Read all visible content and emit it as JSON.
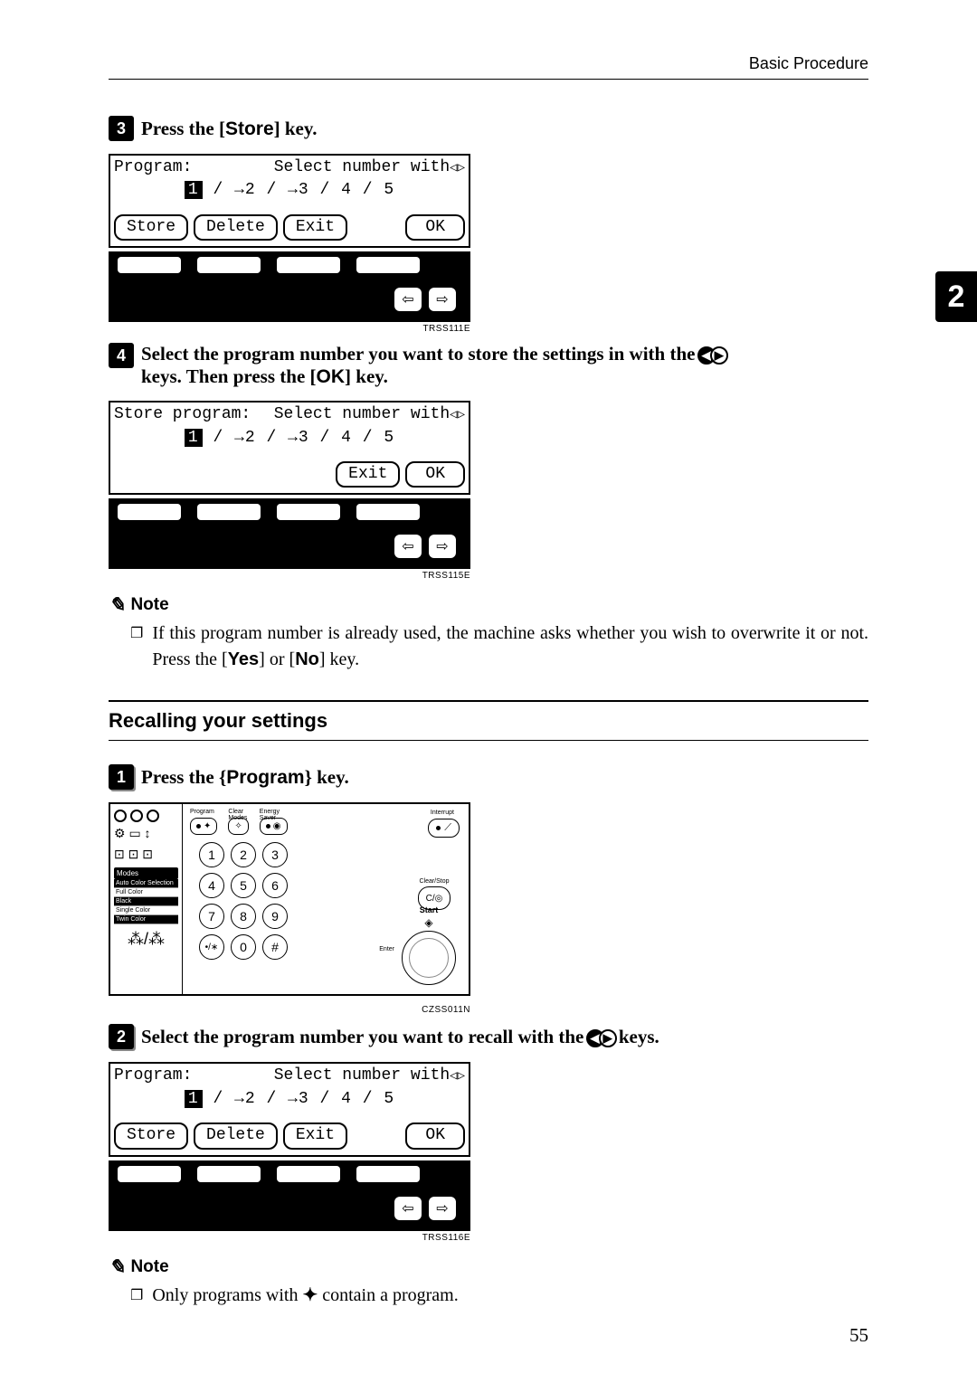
{
  "header": {
    "section": "Basic Procedure"
  },
  "chapter_tab": "2",
  "page_number": "55",
  "steps_a": [
    {
      "num": "3",
      "prefix": "Press the ",
      "key_open": "[",
      "key_label": "Store",
      "key_close": "]",
      "suffix": " key."
    },
    {
      "num": "4",
      "prefix": "Select the program number you want to store the settings in with the ",
      "suffix_line2a": "keys. Then press the ",
      "key2_open": "[",
      "key2_label": "OK",
      "key2_close": "]",
      "suffix_line2b": " key."
    }
  ],
  "figure1": {
    "title_left": "Program:",
    "title_right": "Select number with",
    "row2_sel": "1",
    "row2_rest": " / →2 / →3 /  4  /   5",
    "btns": [
      "Store",
      "Delete",
      "Exit",
      "OK"
    ],
    "code": "TRSS111E"
  },
  "figure2": {
    "title_left": "Store program:",
    "title_right": "Select number with",
    "row2_sel": "1",
    "row2_rest": " / →2 / →3 /  4  /   5",
    "btns": [
      "Exit",
      "OK"
    ],
    "code": "TRSS115E"
  },
  "note1": {
    "heading": "Note",
    "text_a": "If this program number is already used, the machine asks whether you wish to overwrite it or not. Press the ",
    "key1_open": "[",
    "key1": "Yes",
    "key1_close": "]",
    "mid": " or ",
    "key2_open": "[",
    "key2": "No",
    "key2_close": "]",
    "text_b": " key."
  },
  "subsection": {
    "title": "Recalling your settings"
  },
  "steps_b": [
    {
      "num": "1",
      "prefix": "Press the ",
      "key_open": "{",
      "key_label": "Program",
      "key_close": "}",
      "suffix": " key."
    },
    {
      "num": "2",
      "prefix": "Select the program number you want to recall with the ",
      "suffix": " keys."
    }
  ],
  "panel": {
    "top_labels": [
      "Program",
      "Clear Modes",
      "Energy Saver"
    ],
    "interrupt": "Interrupt",
    "modes_header": "Modes",
    "modes": [
      "Auto Color Selection",
      "Full Color",
      "Black",
      "Single Color",
      "Twin Color"
    ],
    "keypad": [
      [
        "1",
        "2",
        "3"
      ],
      [
        "4",
        "5",
        "6"
      ],
      [
        "7",
        "8",
        "9"
      ],
      [
        "•/∗",
        "0",
        "#"
      ]
    ],
    "clear_stop": "Clear/Stop",
    "clear_stop_btn": "C/◎",
    "start": "Start",
    "enter": "Enter",
    "code": "CZSS011N"
  },
  "figure3": {
    "title_left": "Program:",
    "title_right": "Select number with",
    "row2_sel": "1",
    "row2_rest": " / →2 / →3 /  4  /   5",
    "btns": [
      "Store",
      "Delete",
      "Exit",
      "OK"
    ],
    "code": "TRSS116E"
  },
  "note2": {
    "heading": "Note",
    "text_a": "Only programs with ",
    "text_b": " contain a program."
  }
}
